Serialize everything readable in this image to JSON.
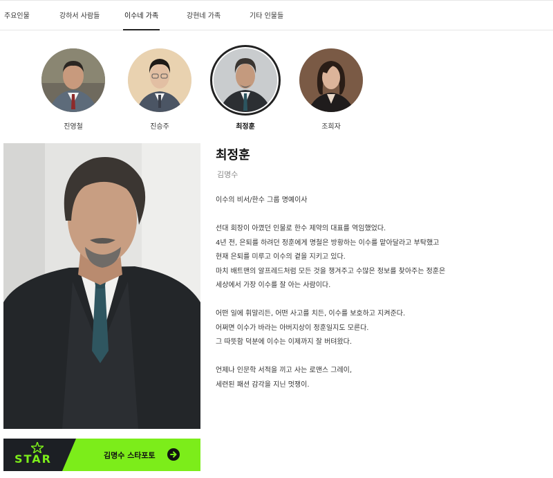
{
  "tabs": [
    {
      "label": "주요인물",
      "active": false
    },
    {
      "label": "강하서 사람들",
      "active": false
    },
    {
      "label": "이수네 가족",
      "active": true
    },
    {
      "label": "강현네 가족",
      "active": false
    },
    {
      "label": "기타 인물들",
      "active": false
    }
  ],
  "cast": [
    {
      "name": "진영철",
      "selected": false
    },
    {
      "name": "진승주",
      "selected": false
    },
    {
      "name": "최정훈",
      "selected": true
    },
    {
      "name": "조희자",
      "selected": false
    }
  ],
  "profile": {
    "actor_name": "최정훈",
    "role_name": "김명수",
    "description": [
      [
        "이수의 비서/한수 그룹 명예이사"
      ],
      [
        "선대 회장이 아꼈던 인물로 한수 제약의 대표를 역임했었다.",
        "4년 전, 은퇴를 하려던 정훈에게 명철은 방황하는 이수를 맡아달라고 부탁했고",
        "현재 은퇴를 미루고 이수의 곁을 지키고 있다.",
        "마치 배트맨의 알프레드처럼 모든 것을 챙겨주고 수많은 정보를 찾아주는 정훈은",
        "세상에서 가장 이수를 잘 아는 사람이다."
      ],
      [
        "어떤 일에 휘말리든, 어떤 사고를 치든, 이수를 보호하고 지켜준다.",
        "어쩌면 이수가 바라는 아버지상이 정훈일지도 모른다.",
        "그 따뜻함 덕분에 이수는 이제까지 잘 버텨왔다."
      ],
      [
        "언제나 인문학 서적을 끼고 사는 로맨스 그레이,",
        "세련된 패션 감각을 지닌 멋쟁이."
      ]
    ]
  },
  "banner": {
    "logo_text": "STAR",
    "label": "김명수 스타포토",
    "icon": "arrow-right-circle-icon",
    "accent_color": "#7ced1a",
    "dark_color": "#1c1f24"
  }
}
